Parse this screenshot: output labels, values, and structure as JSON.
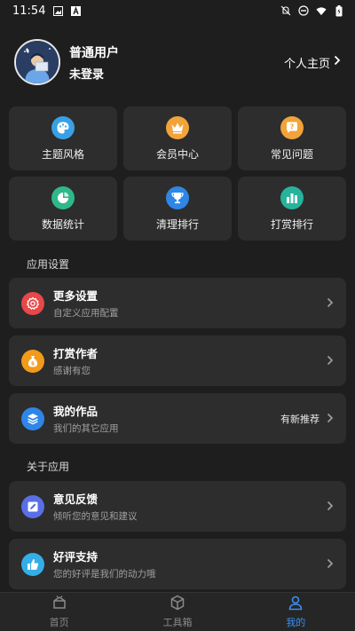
{
  "status": {
    "time": "11:54",
    "left_icons": [
      "image-icon",
      "font-icon"
    ],
    "right_icons": [
      "mute-icon",
      "dnd-icon",
      "wifi-icon",
      "battery-icon"
    ]
  },
  "profile": {
    "name": "普通用户",
    "status": "未登录",
    "homepage_link": "个人主页"
  },
  "grid": [
    {
      "label": "主题风格",
      "icon": "palette-icon",
      "color": "#3aa0e6"
    },
    {
      "label": "会员中心",
      "icon": "crown-icon",
      "color": "#f2a33a"
    },
    {
      "label": "常见问题",
      "icon": "question-chat-icon",
      "color": "#f2a33a"
    },
    {
      "label": "数据统计",
      "icon": "pie-chart-icon",
      "color": "#2fb88a"
    },
    {
      "label": "清理排行",
      "icon": "trophy-icon",
      "color": "#2e86e6"
    },
    {
      "label": "打赏排行",
      "icon": "bar-chart-icon",
      "color": "#26b39c"
    }
  ],
  "sections": {
    "app_settings": "应用设置",
    "about_app": "关于应用"
  },
  "rows": [
    {
      "title": "更多设置",
      "sub": "自定义应用配置",
      "icon": "settings-icon",
      "color": "#e84848",
      "extra": ""
    },
    {
      "title": "打赏作者",
      "sub": "感谢有您",
      "icon": "money-bag-icon",
      "color": "#f29a1a",
      "extra": ""
    },
    {
      "title": "我的作品",
      "sub": "我们的其它应用",
      "icon": "layers-icon",
      "color": "#2e86e6",
      "extra": "有新推荐"
    },
    {
      "title": "意见反馈",
      "sub": "倾听您的意见和建议",
      "icon": "edit-icon",
      "color": "#5a6fe6",
      "extra": ""
    },
    {
      "title": "好评支持",
      "sub": "您的好评是我们的动力哦",
      "icon": "thumbs-up-icon",
      "color": "#35aee8",
      "extra": ""
    }
  ],
  "tabs": [
    {
      "label": "首页",
      "icon": "home-icon",
      "active": false
    },
    {
      "label": "工具箱",
      "icon": "toolbox-icon",
      "active": false
    },
    {
      "label": "我的",
      "icon": "person-icon",
      "active": true
    }
  ],
  "colors": {
    "background": "#1e1e1e",
    "card": "#2d2d2d",
    "accent": "#3b8ef0"
  }
}
